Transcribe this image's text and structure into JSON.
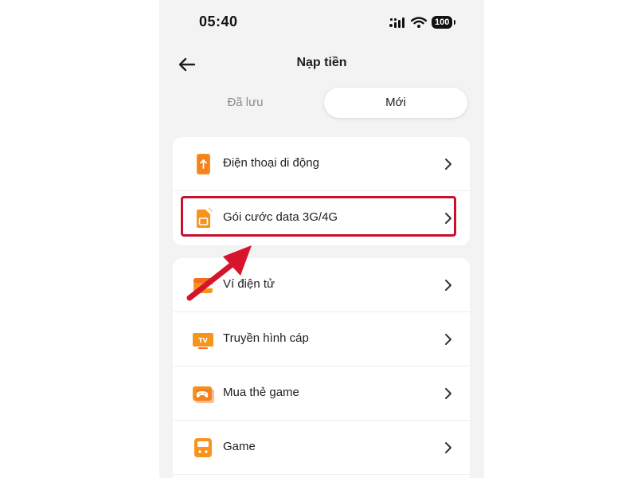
{
  "status_bar": {
    "time": "05:40",
    "battery": "100"
  },
  "header": {
    "title": "Nạp tiền"
  },
  "tabs": [
    {
      "label": "Đã lưu",
      "selected": false
    },
    {
      "label": "Mới",
      "selected": true
    }
  ],
  "groups": [
    {
      "items": [
        {
          "label": "Điện thoại di động",
          "icon": "phone-topup-icon"
        },
        {
          "label": "Gói cước data 3G/4G",
          "icon": "sim-card-icon",
          "highlighted": true
        }
      ]
    },
    {
      "items": [
        {
          "label": "Ví điện tử",
          "icon": "wallet-icon"
        },
        {
          "label": "Truyền hình cáp",
          "icon": "tv-icon"
        },
        {
          "label": "Mua thẻ game",
          "icon": "gamepad-card-icon"
        },
        {
          "label": "Game",
          "icon": "handheld-game-icon"
        }
      ]
    }
  ],
  "colors": {
    "accent": "#f7941d",
    "highlight": "#c8102e",
    "background": "#f3f3f4"
  }
}
